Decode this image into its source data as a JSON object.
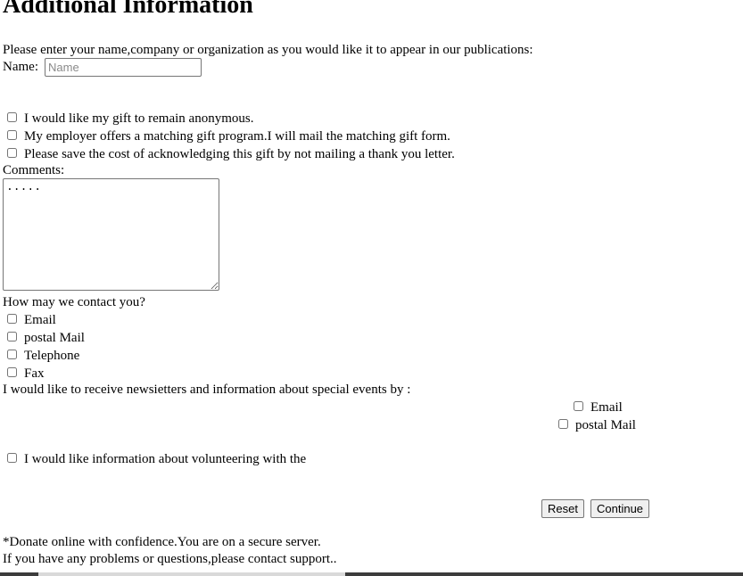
{
  "heading": "Additional Information",
  "name_prompt": "Please enter your name,company or organization as you would like it to appear in our publications:",
  "name_label": "Name:",
  "name_placeholder": "Name",
  "gift_options": [
    "I would like my gift to remain anonymous.",
    "My employer offers a matching gift program.I will mail the matching gift form.",
    "Please save the cost of acknowledging this gift by not mailing a thank you letter."
  ],
  "comments_label": "Comments:",
  "comments_value": ".....",
  "contact_prompt": "How may we contact you?",
  "contact_options": [
    "Email",
    "postal Mail",
    "Telephone",
    "Fax"
  ],
  "newsletter_prompt": "I would like to receive newsietters and information about special events by :",
  "newsletter_options": [
    "Email",
    "postal Mail"
  ],
  "volunteer_label": "I would like information about volunteering with the",
  "buttons": {
    "reset": "Reset",
    "continue": "Continue"
  },
  "footer": {
    "secure_note": "*Donate online with confidence.You are on a secure server.",
    "support_note": "If you have any problems or questions,please contact support.."
  }
}
